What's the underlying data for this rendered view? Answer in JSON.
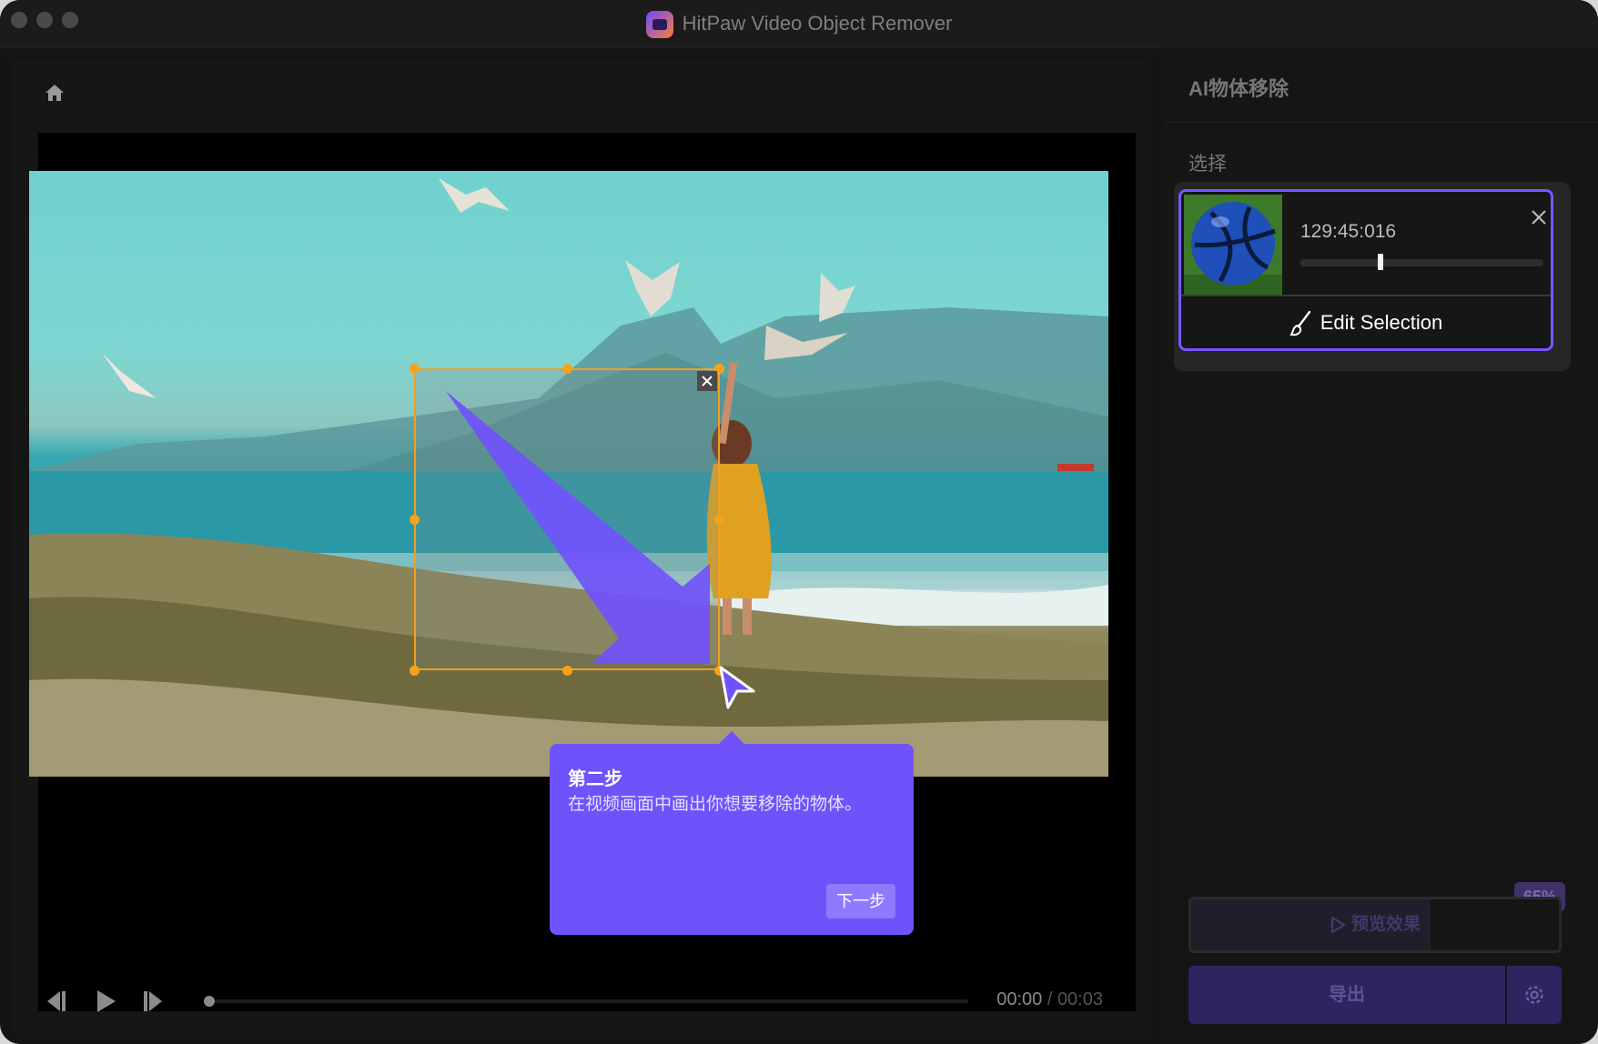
{
  "window": {
    "title": "HitPaw Video Object Remover"
  },
  "player": {
    "time_current": "00:00",
    "time_separator": " / ",
    "time_total": "00:03"
  },
  "guide": {
    "step_title": "第二步",
    "step_text": "在视频画面中画出你想要移除的物体。",
    "next_label": "下一步"
  },
  "sidebar": {
    "title": "AI物体移除",
    "section_label": "选择",
    "selection_card": {
      "timestamp": "129:45:016",
      "track_position": 0.32,
      "edit_label": "Edit Selection"
    },
    "progress_label": "65%",
    "progress_value": 0.65,
    "preview_label": "预览效果",
    "export_label": "导出"
  },
  "colors": {
    "accent": "#7052fb",
    "selection_border": "#f0a020",
    "card_border": "#7a55ff"
  }
}
